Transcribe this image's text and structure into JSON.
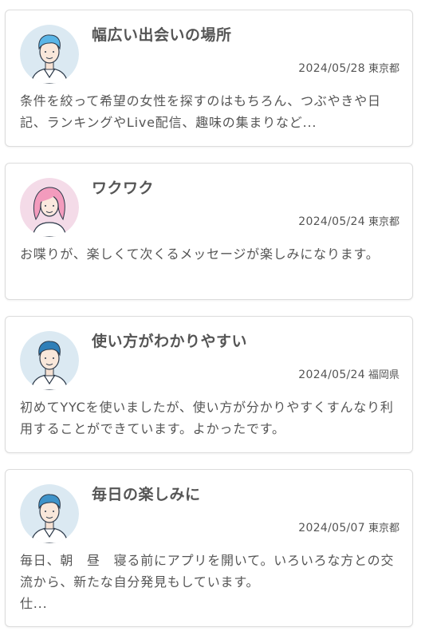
{
  "reviews": [
    {
      "title": "幅広い出会いの場所",
      "date": "2024/05/28",
      "prefecture": "東京都",
      "body": "条件を絞って希望の女性を探すのはもちろん、つぶやきや日記、ランキングやLive配信、趣味の集まりなど...",
      "avatar": "male-avatar"
    },
    {
      "title": "ワクワク",
      "date": "2024/05/24",
      "prefecture": "東京都",
      "body": "お喋りが、楽しくて次くるメッセージが楽しみになります。",
      "avatar": "female-avatar"
    },
    {
      "title": "使い方がわかりやすい",
      "date": "2024/05/24",
      "prefecture": "福岡県",
      "body": "初めてYYCを使いましたが、使い方が分かりやすくすんなり利用することができています。よかったです。",
      "avatar": "male-avatar"
    },
    {
      "title": "毎日の楽しみに",
      "date": "2024/05/07",
      "prefecture": "東京都",
      "body": "毎日、朝　昼　寝る前にアプリを開いて。いろいろな方との交流から、新たな自分発見もしています。\n仕...",
      "avatar": "male-avatar"
    }
  ]
}
